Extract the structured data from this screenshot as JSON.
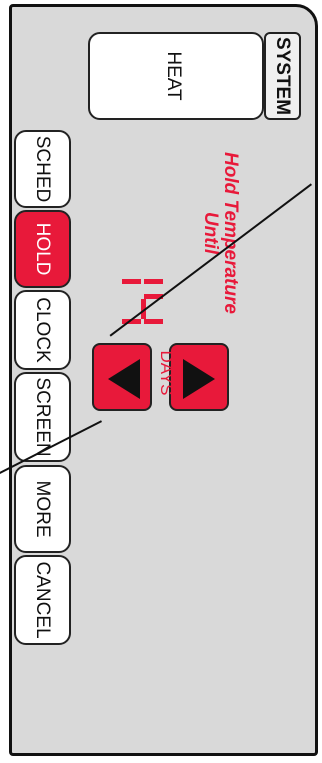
{
  "system": {
    "label": "SYSTEM"
  },
  "mode": {
    "label": "HEAT"
  },
  "hold_info": {
    "line1": "Hold Temperature",
    "line2": "Until",
    "value": "14",
    "unit_label": "DAYS"
  },
  "side_buttons": [
    {
      "label": "SCHED",
      "active": false
    },
    {
      "label": "HOLD",
      "active": true
    },
    {
      "label": "CLOCK",
      "active": false
    },
    {
      "label": "SCREEN",
      "active": false
    },
    {
      "label": "MORE",
      "active": false
    },
    {
      "label": "CANCEL",
      "active": false
    }
  ],
  "colors": {
    "accent": "#e8193a",
    "panel": "#d9d9d9"
  }
}
